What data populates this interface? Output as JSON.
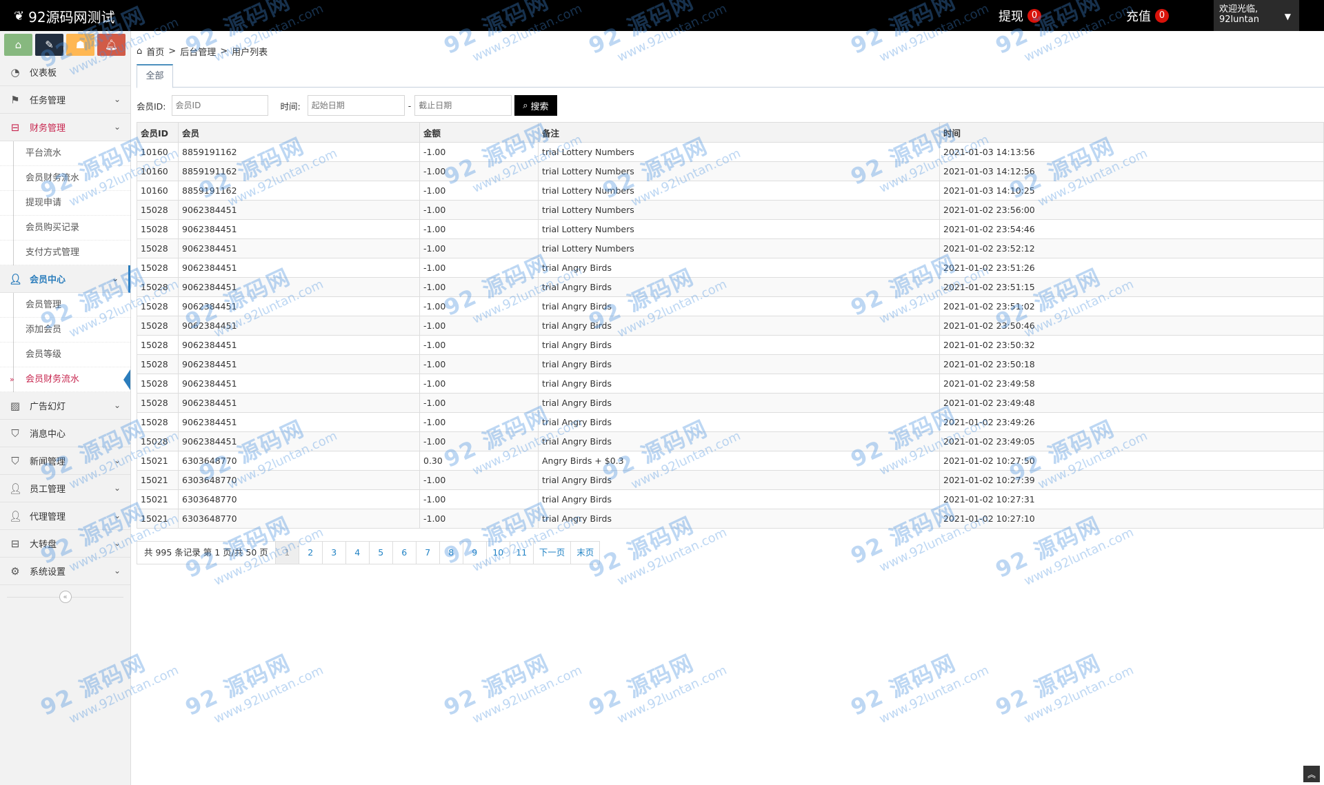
{
  "app": {
    "title": "92源码网测试",
    "withdraw_label": "提现",
    "withdraw_count": "0",
    "recharge_label": "充值",
    "recharge_count": "0",
    "welcome": "欢迎光临,",
    "username": "92luntan"
  },
  "sidebar": {
    "items": [
      {
        "label": "仪表板",
        "icon": "dashboard-icon"
      },
      {
        "label": "任务管理",
        "icon": "flag-icon"
      },
      {
        "label": "财务管理",
        "icon": "tray-icon"
      },
      {
        "label": "会员中心",
        "icon": "user-icon"
      },
      {
        "label": "广告幻灯",
        "icon": "picture-icon"
      },
      {
        "label": "消息中心",
        "icon": "bookmark-icon"
      },
      {
        "label": "新闻管理",
        "icon": "bookmark-icon"
      },
      {
        "label": "员工管理",
        "icon": "user-icon"
      },
      {
        "label": "代理管理",
        "icon": "user-icon"
      },
      {
        "label": "大转盘",
        "icon": "tray-icon"
      },
      {
        "label": "系统设置",
        "icon": "gear-icon"
      }
    ],
    "finance_sub": [
      "平台流水",
      "会员财务流水",
      "提现申请",
      "会员购买记录",
      "支付方式管理"
    ],
    "member_sub": [
      "会员管理",
      "添加会员",
      "会员等级",
      "会员财务流水"
    ]
  },
  "breadcrumb": {
    "home": "首页",
    "level1": "后台管理",
    "level2": "用户列表",
    "sep": ">"
  },
  "tabs": {
    "all": "全部"
  },
  "filter": {
    "member_label": "会员ID:",
    "member_placeholder": "会员ID",
    "time_label": "时间:",
    "start_placeholder": "起始日期",
    "dash": "-",
    "end_placeholder": "截止日期",
    "search_label": "搜索"
  },
  "table": {
    "headers": [
      "会员ID",
      "会员",
      "金额",
      "备注",
      "时间"
    ],
    "rows": [
      [
        "10160",
        "8859191162",
        "-1.00",
        "trial Lottery Numbers",
        "2021-01-03 14:13:56"
      ],
      [
        "10160",
        "8859191162",
        "-1.00",
        "trial Lottery Numbers",
        "2021-01-03 14:12:56"
      ],
      [
        "10160",
        "8859191162",
        "-1.00",
        "trial Lottery Numbers",
        "2021-01-03 14:10:25"
      ],
      [
        "15028",
        "9062384451",
        "-1.00",
        "trial Lottery Numbers",
        "2021-01-02 23:56:00"
      ],
      [
        "15028",
        "9062384451",
        "-1.00",
        "trial Lottery Numbers",
        "2021-01-02 23:54:46"
      ],
      [
        "15028",
        "9062384451",
        "-1.00",
        "trial Lottery Numbers",
        "2021-01-02 23:52:12"
      ],
      [
        "15028",
        "9062384451",
        "-1.00",
        "trial Angry Birds",
        "2021-01-02 23:51:26"
      ],
      [
        "15028",
        "9062384451",
        "-1.00",
        "trial Angry Birds",
        "2021-01-02 23:51:15"
      ],
      [
        "15028",
        "9062384451",
        "-1.00",
        "trial Angry Birds",
        "2021-01-02 23:51:02"
      ],
      [
        "15028",
        "9062384451",
        "-1.00",
        "trial Angry Birds",
        "2021-01-02 23:50:46"
      ],
      [
        "15028",
        "9062384451",
        "-1.00",
        "trial Angry Birds",
        "2021-01-02 23:50:32"
      ],
      [
        "15028",
        "9062384451",
        "-1.00",
        "trial Angry Birds",
        "2021-01-02 23:50:18"
      ],
      [
        "15028",
        "9062384451",
        "-1.00",
        "trial Angry Birds",
        "2021-01-02 23:49:58"
      ],
      [
        "15028",
        "9062384451",
        "-1.00",
        "trial Angry Birds",
        "2021-01-02 23:49:48"
      ],
      [
        "15028",
        "9062384451",
        "-1.00",
        "trial Angry Birds",
        "2021-01-02 23:49:26"
      ],
      [
        "15028",
        "9062384451",
        "-1.00",
        "trial Angry Birds",
        "2021-01-02 23:49:05"
      ],
      [
        "15021",
        "6303648770",
        "0.30",
        "Angry Birds + $0.3",
        "2021-01-02 10:27:50"
      ],
      [
        "15021",
        "6303648770",
        "-1.00",
        "trial Angry Birds",
        "2021-01-02 10:27:39"
      ],
      [
        "15021",
        "6303648770",
        "-1.00",
        "trial Angry Birds",
        "2021-01-02 10:27:31"
      ],
      [
        "15021",
        "6303648770",
        "-1.00",
        "trial Angry Birds",
        "2021-01-02 10:27:10"
      ]
    ]
  },
  "pager": {
    "info": "共 995 条记录 第 1 页/共 50 页",
    "pages": [
      "1",
      "2",
      "3",
      "4",
      "5",
      "6",
      "7",
      "8",
      "9",
      "10",
      "11",
      "下一页",
      "末页"
    ]
  },
  "watermark": {
    "line1": "92 源码网",
    "line2": "www.92luntan.com"
  },
  "colors": {
    "accent": "#2b7dbc",
    "active": "#c7254e",
    "badge": "#d9120a"
  }
}
